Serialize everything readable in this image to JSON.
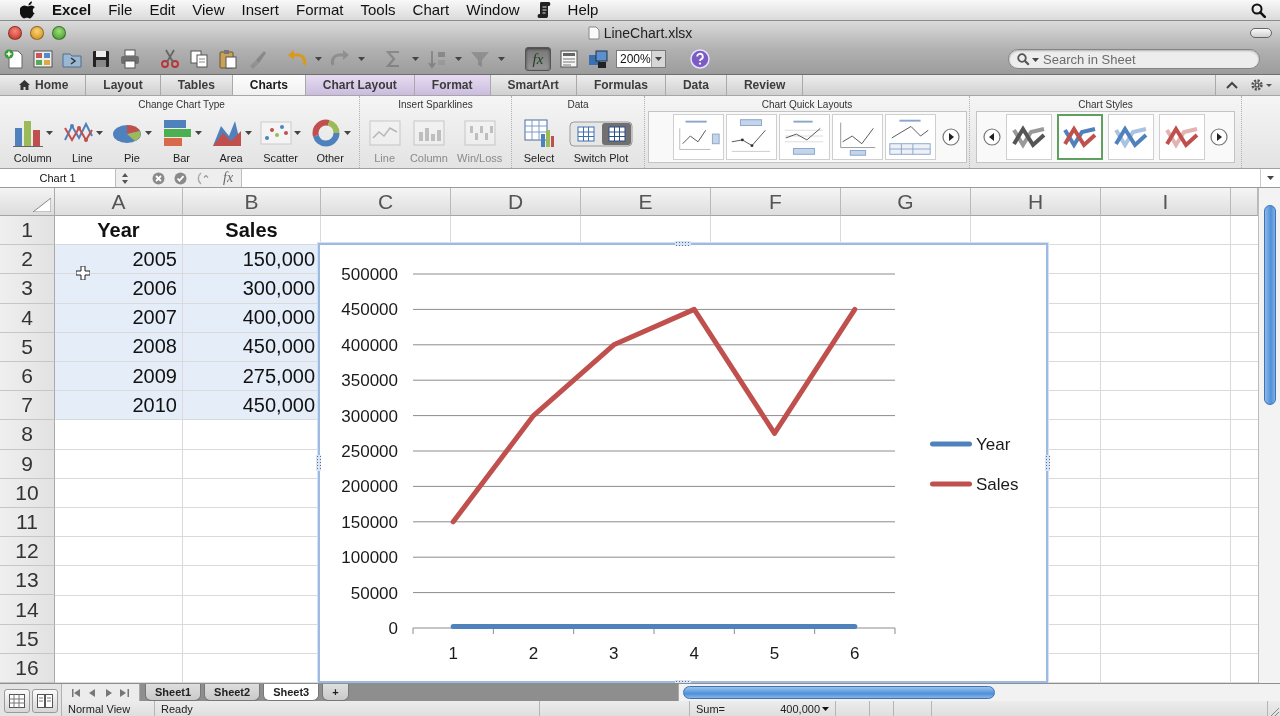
{
  "menu_bar": {
    "items": [
      {
        "kind": "app",
        "label": "Excel"
      },
      {
        "kind": "menu",
        "label": "File"
      },
      {
        "kind": "menu",
        "label": "Edit"
      },
      {
        "kind": "menu",
        "label": "View"
      },
      {
        "kind": "menu",
        "label": "Insert"
      },
      {
        "kind": "menu",
        "label": "Format"
      },
      {
        "kind": "menu",
        "label": "Tools"
      },
      {
        "kind": "menu",
        "label": "Chart"
      },
      {
        "kind": "menu",
        "label": "Window"
      },
      {
        "kind": "script"
      },
      {
        "kind": "menu",
        "label": "Help"
      }
    ]
  },
  "window": {
    "title": "LineChart.xlsx"
  },
  "toolbar": {
    "formula_builder": {
      "label": "fx",
      "selected": true
    },
    "zoom": "200%",
    "search": {
      "placeholder": "Search in Sheet"
    }
  },
  "ribbon": {
    "tabs": [
      {
        "label": "Home",
        "kind": "home",
        "selected": false,
        "contextual": false
      },
      {
        "label": "Layout",
        "kind": "plain",
        "selected": false,
        "contextual": false
      },
      {
        "label": "Tables",
        "kind": "plain",
        "selected": false,
        "contextual": false
      },
      {
        "label": "Charts",
        "kind": "plain",
        "selected": true,
        "contextual": false
      },
      {
        "label": "Chart Layout",
        "kind": "plain",
        "selected": false,
        "contextual": true
      },
      {
        "label": "Format",
        "kind": "plain",
        "selected": false,
        "contextual": true
      },
      {
        "label": "SmartArt",
        "kind": "plain",
        "selected": false,
        "contextual": false
      },
      {
        "label": "Formulas",
        "kind": "plain",
        "selected": false,
        "contextual": false
      },
      {
        "label": "Data",
        "kind": "plain",
        "selected": false,
        "contextual": false
      },
      {
        "label": "Review",
        "kind": "plain",
        "selected": false,
        "contextual": false
      }
    ],
    "groups": [
      {
        "title": "Change Chart Type",
        "kind": "buttons",
        "buttons": [
          {
            "label": "Column",
            "kind": "column",
            "dropdown": true,
            "disabled": false
          },
          {
            "label": "Line",
            "kind": "line",
            "dropdown": true,
            "disabled": false
          },
          {
            "label": "Pie",
            "kind": "pie",
            "dropdown": true,
            "disabled": false
          },
          {
            "label": "Bar",
            "kind": "bar",
            "dropdown": true,
            "disabled": false
          },
          {
            "label": "Area",
            "kind": "area",
            "dropdown": true,
            "disabled": false
          },
          {
            "label": "Scatter",
            "kind": "scatter",
            "dropdown": true,
            "disabled": false
          },
          {
            "label": "Other",
            "kind": "other",
            "dropdown": true,
            "disabled": false
          }
        ]
      },
      {
        "title": "Insert Sparklines",
        "kind": "buttons",
        "buttons": [
          {
            "label": "Line",
            "kind": "sparkline-line",
            "dropdown": false,
            "disabled": true
          },
          {
            "label": "Column",
            "kind": "sparkline-column",
            "dropdown": false,
            "disabled": true
          },
          {
            "label": "Win/Loss",
            "kind": "sparkline-winloss",
            "dropdown": false,
            "disabled": true
          }
        ]
      },
      {
        "title": "Data",
        "kind": "buttons",
        "buttons": [
          {
            "label": "Select",
            "kind": "select",
            "dropdown": false,
            "disabled": false
          },
          {
            "label": "Switch Plot",
            "kind": "switch",
            "dropdown": false,
            "disabled": false
          }
        ]
      },
      {
        "title": "Chart Quick Layouts",
        "kind": "layouts",
        "options": [
          {
            "selected": false
          },
          {
            "selected": false
          },
          {
            "selected": false
          },
          {
            "selected": false
          },
          {
            "selected": false
          }
        ]
      },
      {
        "title": "Chart Styles",
        "kind": "styles",
        "options": [
          {
            "selected": false
          },
          {
            "selected": true
          },
          {
            "selected": false
          },
          {
            "selected": false
          }
        ]
      }
    ]
  },
  "formula_bar": {
    "name_box": "Chart 1",
    "function_label": "fx"
  },
  "sheet": {
    "columns": [
      "A",
      "B",
      "C",
      "D",
      "E",
      "F",
      "G",
      "H",
      "I"
    ],
    "rows": [
      {
        "header": "1",
        "highlighted": false,
        "cells": [
          {
            "text": "Year",
            "kind": "heading"
          },
          {
            "text": "Sales",
            "kind": "heading"
          }
        ]
      },
      {
        "header": "2",
        "highlighted": true,
        "cells": [
          {
            "text": "2005",
            "kind": "number"
          },
          {
            "text": "150,000",
            "kind": "number"
          }
        ]
      },
      {
        "header": "3",
        "highlighted": true,
        "cells": [
          {
            "text": "2006",
            "kind": "number"
          },
          {
            "text": "300,000",
            "kind": "number"
          }
        ]
      },
      {
        "header": "4",
        "highlighted": true,
        "cells": [
          {
            "text": "2007",
            "kind": "number"
          },
          {
            "text": "400,000",
            "kind": "number"
          }
        ]
      },
      {
        "header": "5",
        "highlighted": true,
        "cells": [
          {
            "text": "2008",
            "kind": "number"
          },
          {
            "text": "450,000",
            "kind": "number"
          }
        ]
      },
      {
        "header": "6",
        "highlighted": true,
        "cells": [
          {
            "text": "2009",
            "kind": "number"
          },
          {
            "text": "275,000",
            "kind": "number"
          }
        ]
      },
      {
        "header": "7",
        "highlighted": true,
        "cells": [
          {
            "text": "2010",
            "kind": "number"
          },
          {
            "text": "450,000",
            "kind": "number"
          }
        ]
      },
      {
        "header": "8",
        "highlighted": false
      },
      {
        "header": "9",
        "highlighted": false
      },
      {
        "header": "10",
        "highlighted": false
      },
      {
        "header": "11",
        "highlighted": false
      },
      {
        "header": "12",
        "highlighted": false
      },
      {
        "header": "13",
        "highlighted": false
      },
      {
        "header": "14",
        "highlighted": false
      },
      {
        "header": "15",
        "highlighted": false
      },
      {
        "header": "16",
        "highlighted": false
      }
    ]
  },
  "chart": {
    "chart_data": {
      "type": "line",
      "categories": [
        "1",
        "2",
        "3",
        "4",
        "5",
        "6"
      ],
      "series": [
        {
          "name": "Year",
          "color": "#4f81bd",
          "values": [
            2005,
            2006,
            2007,
            2008,
            2009,
            2010
          ]
        },
        {
          "name": "Sales",
          "color": "#c0504d",
          "values": [
            150000,
            300000,
            400000,
            450000,
            275000,
            450000
          ]
        }
      ],
      "ylim": [
        0,
        500000
      ],
      "yticks": [
        0,
        50000,
        100000,
        150000,
        200000,
        250000,
        300000,
        350000,
        400000,
        450000,
        500000
      ],
      "grid": true,
      "legend": true
    }
  },
  "sheet_tabs": {
    "tabs": [
      {
        "label": "Sheet1",
        "selected": false
      },
      {
        "label": "Sheet2",
        "selected": false
      },
      {
        "label": "Sheet3",
        "selected": true
      }
    ],
    "add_label": "+"
  },
  "status_bar": {
    "view": "Normal View",
    "status": "Ready",
    "sum_label": "Sum=",
    "sum_value": "400,000"
  }
}
